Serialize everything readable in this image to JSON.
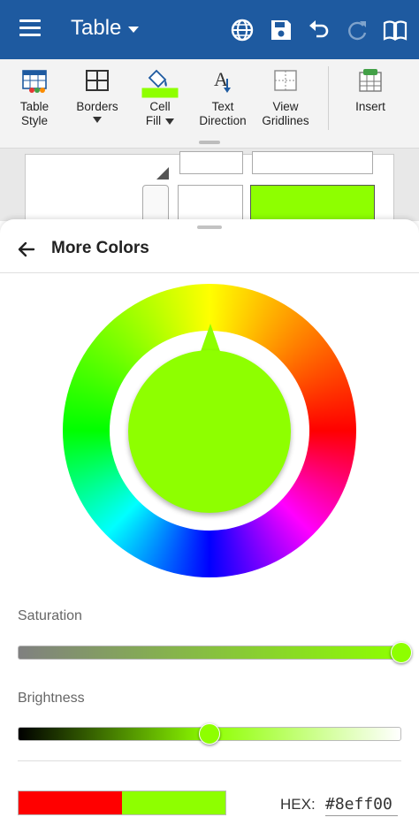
{
  "header": {
    "title": "Table",
    "icons": [
      "menu-icon",
      "globe-icon",
      "save-icon",
      "undo-icon",
      "redo-icon",
      "book-icon"
    ]
  },
  "ribbon": {
    "items": [
      {
        "line1": "Table",
        "line2": "Style",
        "icon": "table-style-icon"
      },
      {
        "line1": "Borders",
        "line2": "",
        "icon": "borders-icon",
        "dropdown": true
      },
      {
        "line1": "Cell",
        "line2": "Fill",
        "icon": "cell-fill-icon",
        "dropdown": true
      },
      {
        "line1": "Text",
        "line2": "Direction",
        "icon": "text-direction-icon"
      },
      {
        "line1": "View",
        "line2": "Gridlines",
        "icon": "view-gridlines-icon"
      },
      {
        "line1": "Insert",
        "line2": "",
        "icon": "insert-icon"
      }
    ]
  },
  "panel": {
    "title": "More Colors",
    "saturation_label": "Saturation",
    "brightness_label": "Brightness",
    "saturation_value": 1.0,
    "brightness_value": 0.5,
    "hex_label": "HEX:",
    "hex_value": "#8eff00",
    "colors": {
      "selected": "#8eff00",
      "previous": "#ff0000",
      "accent": "#1e5aa0"
    }
  }
}
